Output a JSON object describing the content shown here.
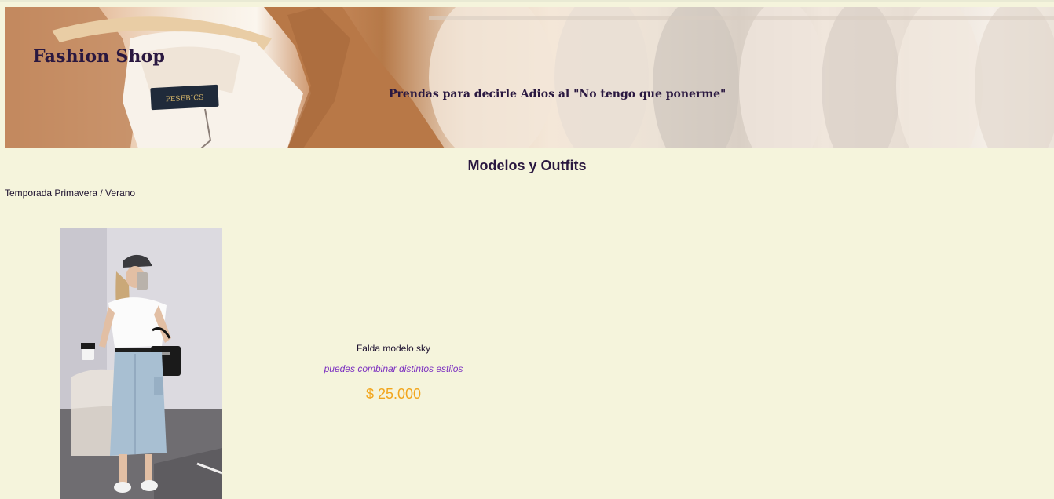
{
  "header": {
    "title": "Fashion Shop",
    "tagline": "Prendas para decirle Adios al \"No tengo que ponerme\"",
    "label_text": "PESEBICS"
  },
  "main": {
    "section_title": "Modelos y Outfits",
    "season": "Temporada Primavera / Verano",
    "products": [
      {
        "name": "Falda modelo sky",
        "description": "puedes combinar distintos estilos",
        "price": "$ 25.000",
        "image": "woman-denim-skirt-photo"
      }
    ]
  },
  "colors": {
    "background": "#f5f4dc",
    "heading": "#2a1840",
    "description": "#7b2fc0",
    "price": "#f2a51c"
  }
}
